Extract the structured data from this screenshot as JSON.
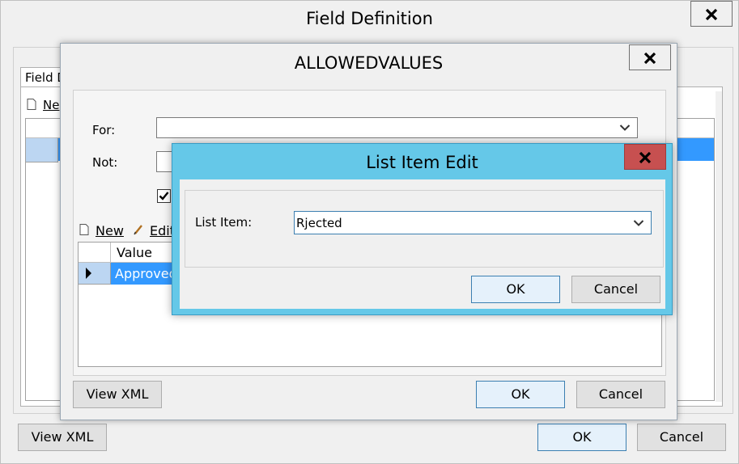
{
  "field_definition": {
    "title": "Field Definition",
    "tab_label_fragment": "Field D",
    "new_fragment": "Ne",
    "view_xml": "View XML",
    "ok": "OK",
    "cancel": "Cancel"
  },
  "allowed_values": {
    "title": "ALLOWEDVALUES",
    "for_label": "For:",
    "not_label": "Not:",
    "for_value": "",
    "not_value": "",
    "checkbox_checked": true,
    "toolbar": {
      "new_label": "New",
      "edit_fragment": "Edit"
    },
    "grid": {
      "column_header": "Value",
      "rows": [
        "Approved"
      ]
    },
    "view_xml": "View XML",
    "ok": "OK",
    "cancel": "Cancel"
  },
  "list_item_edit": {
    "title": "List Item Edit",
    "field_label": "List Item:",
    "field_value": "Rjected",
    "ok": "OK",
    "cancel": "Cancel",
    "title_bar_color": "#65c8e8",
    "close_button_color": "#c75050"
  }
}
